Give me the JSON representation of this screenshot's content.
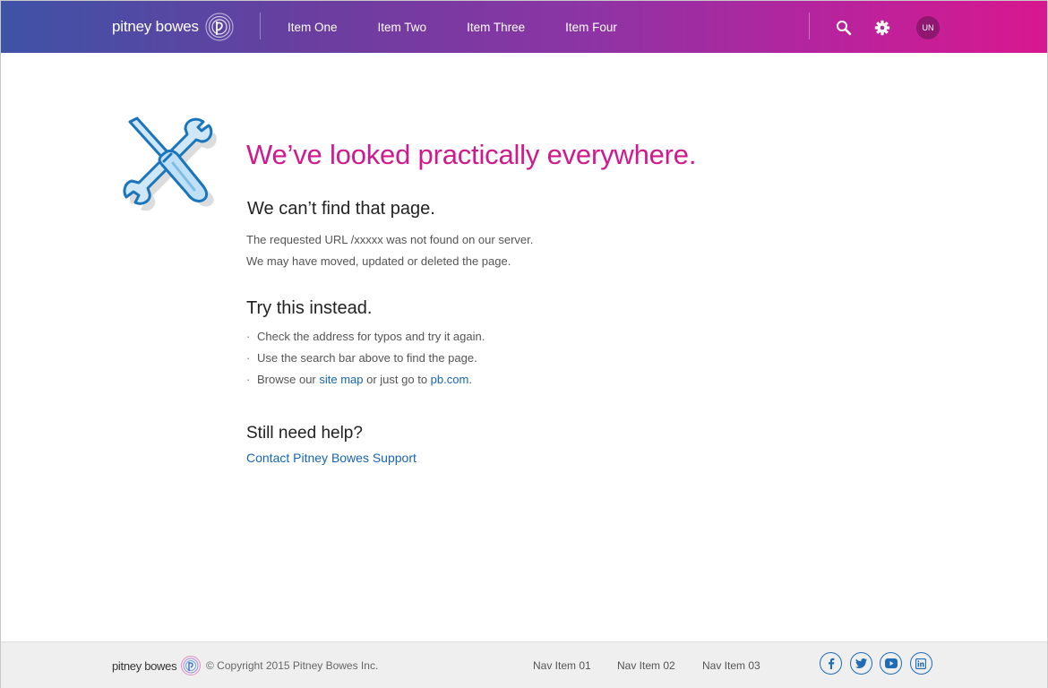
{
  "header": {
    "brand": "pitney bowes",
    "nav": [
      "Item One",
      "Item Two",
      "Item Three",
      "Item Four"
    ],
    "avatar_initials": "UN",
    "icons": [
      "search-icon",
      "gear-icon"
    ]
  },
  "main": {
    "illustration": "wrench-screwdriver-icon",
    "headline": "We’ve looked practically everywhere.",
    "not_found": {
      "heading": "We can’t find that page.",
      "line1": "The requested URL /xxxxx was not found on our server.",
      "line2": "We may have moved, updated or deleted the page."
    },
    "try": {
      "heading": "Try this instead.",
      "bullet1": "Check the address for typos and try it again.",
      "bullet2": "Use the search bar above to find the page.",
      "bullet3_prefix": "Browse our ",
      "bullet3_link1": "site map",
      "bullet3_mid": " or just go to ",
      "bullet3_link2": "pb.com",
      "bullet3_suffix": "."
    },
    "help": {
      "heading": "Still need help?",
      "link": "Contact Pitney Bowes Support"
    }
  },
  "footer": {
    "brand": "pitney bowes",
    "copyright": "© Copyright 2015 Pitney Bowes Inc.",
    "nav": [
      "Nav Item 01",
      "Nav Item 02",
      "Nav Item 03"
    ],
    "social": [
      "facebook-icon",
      "twitter-icon",
      "youtube-icon",
      "linkedin-icon"
    ]
  },
  "colors": {
    "headline_magenta": "#cf1a8e",
    "link_blue": "#1665b3",
    "header_gradient_start": "#3e53a6",
    "header_gradient_end": "#d8188f",
    "avatar": "#8e1770"
  }
}
